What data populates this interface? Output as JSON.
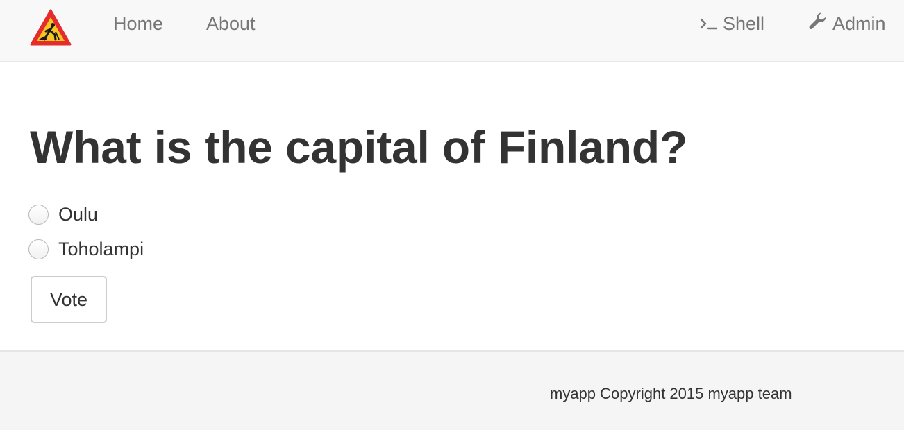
{
  "navbar": {
    "logo_icon": "construction-warning-sign-icon",
    "links": [
      {
        "label": "Home"
      },
      {
        "label": "About"
      }
    ],
    "right_links": [
      {
        "label": "Shell",
        "icon": "terminal-prompt-icon"
      },
      {
        "label": "Admin",
        "icon": "wrench-icon"
      }
    ]
  },
  "poll": {
    "question": "What is the capital of Finland?",
    "choices": [
      {
        "label": "Oulu",
        "selected": false
      },
      {
        "label": "Toholampi",
        "selected": false
      }
    ],
    "vote_label": "Vote"
  },
  "footer": {
    "text": "myapp Copyright 2015 myapp team"
  },
  "colors": {
    "navbar_bg": "#f8f8f8",
    "nav_link": "#777777",
    "text": "#333333",
    "footer_bg": "#f5f5f5",
    "sign_red": "#e52b2b",
    "sign_yellow": "#f7c623"
  }
}
